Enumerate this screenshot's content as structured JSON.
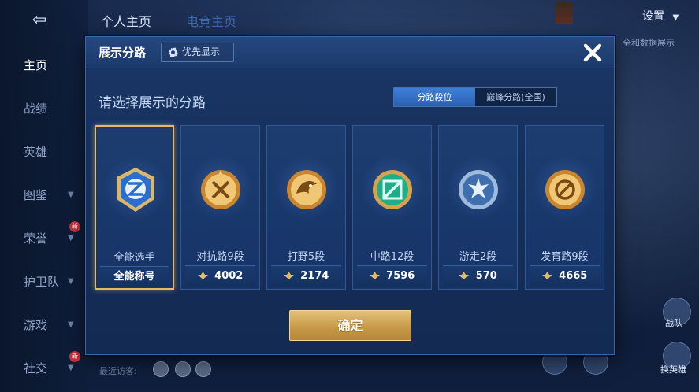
{
  "background": {
    "back_arrow": "⇦",
    "tabs": [
      "个人主页",
      "电竞主页"
    ],
    "settings_label": "设置",
    "right_hint": "全和数据展示",
    "right_buttons": [
      "战队",
      "换英雄"
    ],
    "visitor_label": "最近访客:",
    "nav": [
      {
        "label": "主页",
        "active": true
      },
      {
        "label": "战绩"
      },
      {
        "label": "英雄"
      },
      {
        "label": "图鉴",
        "chevron": true
      },
      {
        "label": "荣誉",
        "chevron": true,
        "badge": "新"
      },
      {
        "label": "护卫队",
        "chevron": true
      },
      {
        "label": "游戏",
        "chevron": true
      },
      {
        "label": "社交",
        "chevron": true,
        "badge": "新"
      }
    ]
  },
  "dialog": {
    "title": "展示分路",
    "priority_button": "优先显示",
    "subtitle": "请选择展示的分路",
    "tabs": [
      {
        "label": "分路段位",
        "active": true
      },
      {
        "label": "巅峰分路(全国)",
        "active": false
      }
    ],
    "cards": [
      {
        "name": "全能选手",
        "stat": "全能称号",
        "selected": true,
        "emblem": "all-round-emblem-icon",
        "color": "#2f7fe0"
      },
      {
        "name": "对抗路9段",
        "stat": "4002",
        "emblem": "clash-lane-emblem-icon",
        "color": "#c9862f"
      },
      {
        "name": "打野5段",
        "stat": "2174",
        "emblem": "jungle-emblem-icon",
        "color": "#c9862f"
      },
      {
        "name": "中路12段",
        "stat": "7596",
        "emblem": "mid-lane-emblem-icon",
        "color": "#1fae8a"
      },
      {
        "name": "游走2段",
        "stat": "570",
        "emblem": "roam-emblem-icon",
        "color": "#5d8fd0"
      },
      {
        "name": "发育路9段",
        "stat": "4665",
        "emblem": "farm-lane-emblem-icon",
        "color": "#c9862f"
      }
    ],
    "confirm_label": "确定"
  },
  "colors": {
    "accent_gold": "#e3b96b",
    "tab_active": "#2f6fc8",
    "dialog_bg": "#16305c"
  }
}
